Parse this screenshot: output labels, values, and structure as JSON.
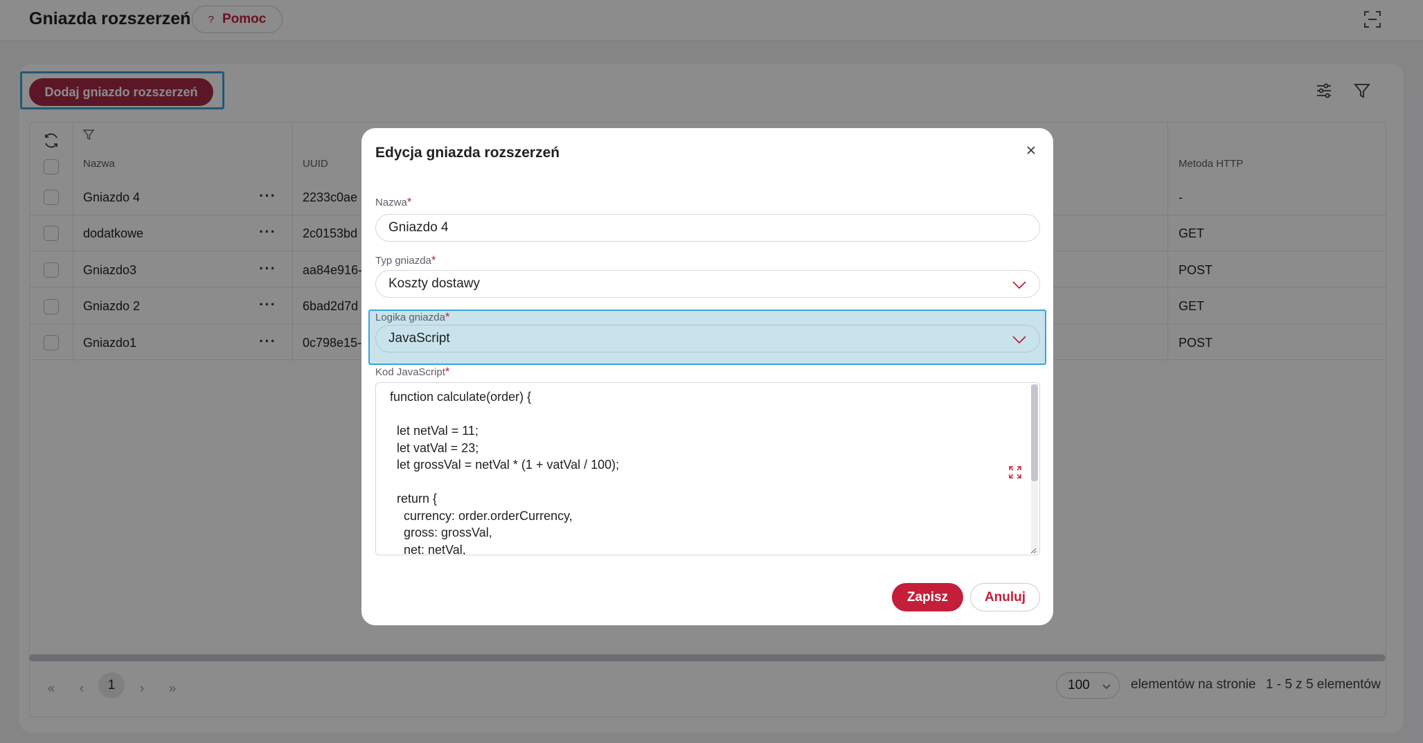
{
  "header": {
    "title": "Gniazda rozszerzeń",
    "help_label": "Pomoc",
    "help_icon": "?"
  },
  "toolbar": {
    "add_label": "Dodaj gniazdo rozszerzeń"
  },
  "table": {
    "columns": [
      "Nazwa",
      "UUID",
      "Metoda HTTP"
    ],
    "rows": [
      {
        "name": "Gniazdo 4",
        "uuid": "2233c0ae",
        "method": "-"
      },
      {
        "name": "dodatkowe",
        "uuid": "2c0153bd",
        "method": "GET"
      },
      {
        "name": "Gniazdo3",
        "uuid": "aa84e916-",
        "method": "POST"
      },
      {
        "name": "Gniazdo 2",
        "uuid": "6bad2d7d",
        "method": "GET"
      },
      {
        "name": "Gniazdo1",
        "uuid": "0c798e15-",
        "method": "POST"
      }
    ],
    "row_menu": "···"
  },
  "pagination": {
    "first": "«",
    "prev": "‹",
    "current_page": "1",
    "next": "›",
    "last": "»",
    "per_page": "100",
    "per_page_label": "elementów na stronie",
    "range": "1 - 5 z 5 elementów"
  },
  "modal": {
    "title": "Edycja gniazda rozszerzeń",
    "required_mark": "*",
    "name_label": "Nazwa",
    "name_value": "Gniazdo 4",
    "type_label": "Typ gniazda",
    "type_value": "Koszty dostawy",
    "logic_label": "Logika gniazda",
    "logic_value": "JavaScript",
    "code_label": "Kod JavaScript",
    "code_value": "function calculate(order) {\n\n  let netVal = 11;\n  let vatVal = 23;\n  let grossVal = netVal * (1 + vatVal / 100);\n\n  return {\n    currency: order.orderCurrency,\n    gross: grossVal,\n    net: netVal,",
    "save_label": "Zapisz",
    "cancel_label": "Anuluj"
  },
  "colors": {
    "accent": "#c41e3a",
    "add_button": "#a82a48",
    "highlight": "#3aa5d6"
  }
}
